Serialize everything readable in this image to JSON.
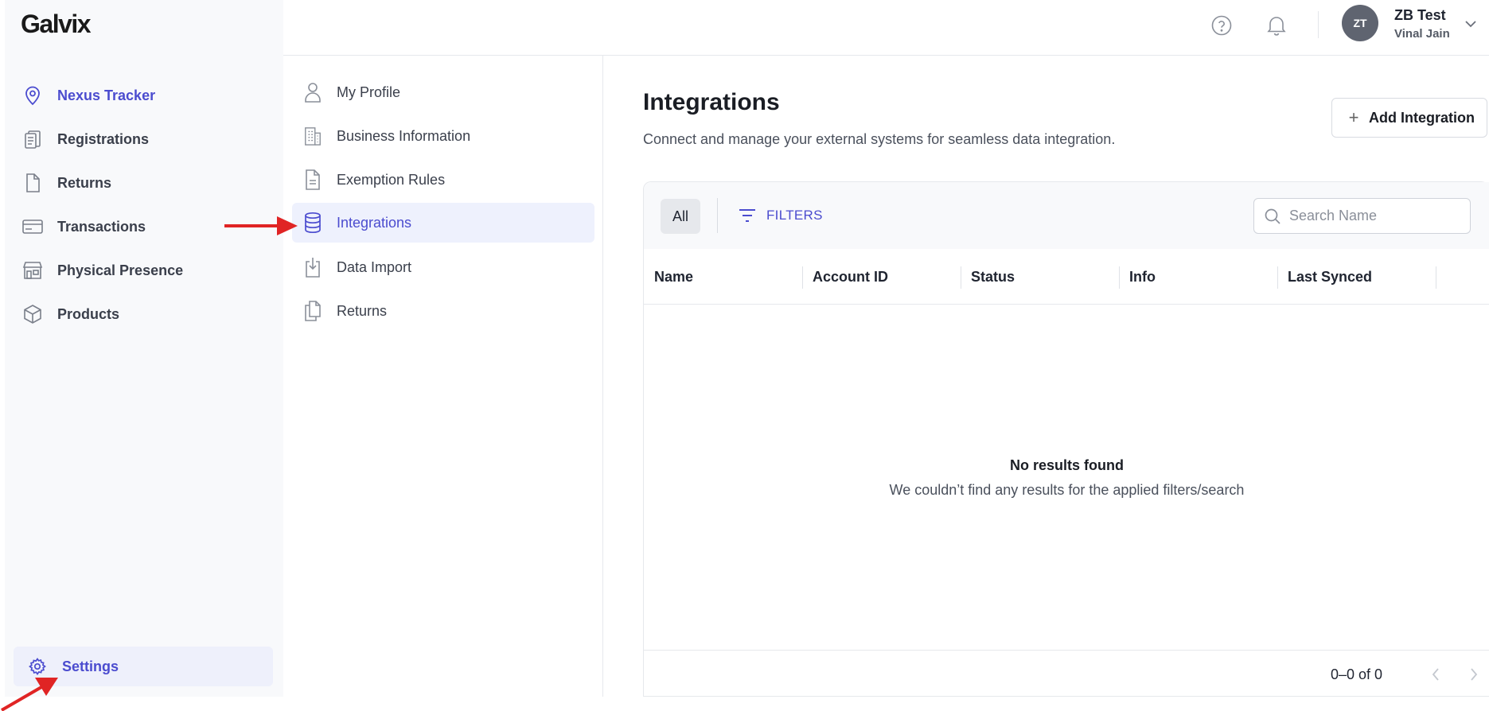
{
  "brand": {
    "logo": "Galvix"
  },
  "sidebar": {
    "items": [
      {
        "label": "Nexus Tracker",
        "icon": "location-pin-icon",
        "active": true
      },
      {
        "label": "Registrations",
        "icon": "clipboard-icon",
        "active": false
      },
      {
        "label": "Returns",
        "icon": "file-icon",
        "active": false
      },
      {
        "label": "Transactions",
        "icon": "credit-card-icon",
        "active": false
      },
      {
        "label": "Physical Presence",
        "icon": "storefront-icon",
        "active": false
      },
      {
        "label": "Products",
        "icon": "box-icon",
        "active": false
      }
    ],
    "settings": {
      "label": "Settings",
      "icon": "gear-icon",
      "active": true
    }
  },
  "header": {
    "help_icon": "help-circle-icon",
    "notification_icon": "bell-icon",
    "user": {
      "initials": "ZT",
      "name": "ZB Test",
      "subtitle": "Vinal Jain"
    }
  },
  "settings_nav": {
    "items": [
      {
        "label": "My Profile",
        "icon": "user-icon",
        "active": false
      },
      {
        "label": "Business Information",
        "icon": "building-icon",
        "active": false
      },
      {
        "label": "Exemption Rules",
        "icon": "document-icon",
        "active": false
      },
      {
        "label": "Integrations",
        "icon": "database-icon",
        "active": true
      },
      {
        "label": "Data Import",
        "icon": "import-icon",
        "active": false
      },
      {
        "label": "Returns",
        "icon": "copy-icon",
        "active": false
      }
    ]
  },
  "main": {
    "title": "Integrations",
    "subtitle": "Connect and manage your external systems for seamless data integration.",
    "add_button": "Add Integration",
    "toolbar": {
      "chip_all": "All",
      "filters": "FILTERS",
      "search_placeholder": "Search Name"
    },
    "table": {
      "columns": [
        "Name",
        "Account ID",
        "Status",
        "Info",
        "Last Synced"
      ],
      "rows": []
    },
    "empty_state": {
      "title": "No results found",
      "subtitle": "We couldn’t find any results for the applied filters/search"
    },
    "pagination": {
      "range": "0–0 of 0"
    }
  },
  "colors": {
    "accent": "#4b4ccf",
    "sidebar_bg": "#f8f9fb",
    "active_bg": "#eef1fd",
    "annotation_arrow": "#e02424"
  }
}
